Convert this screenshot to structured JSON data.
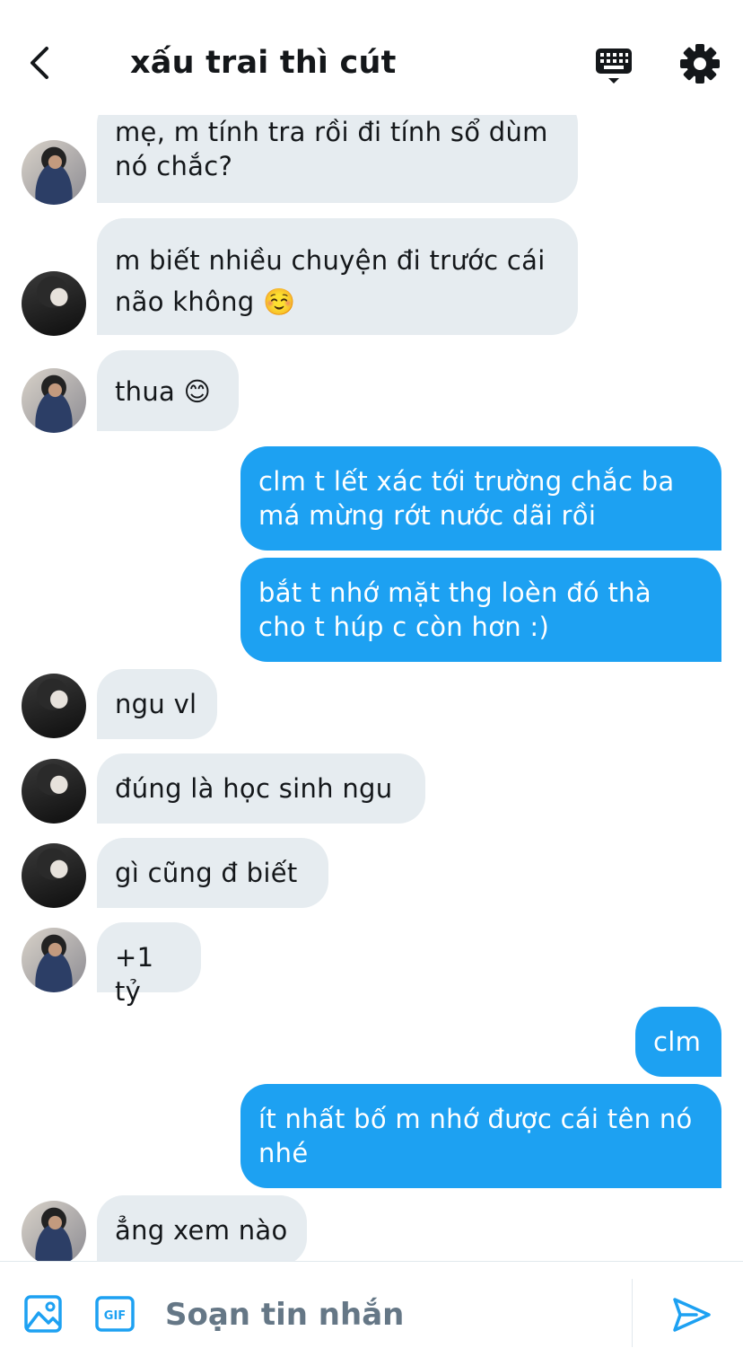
{
  "header": {
    "title": "xấu trai thì cút",
    "back_icon": "chevron-left-icon",
    "keyboard_icon": "keyboard-icon",
    "settings_icon": "gear-icon"
  },
  "messages": [
    {
      "from": "friend-a",
      "text": "mẹ, m tính tra rồi đi tính sổ dùm nó chắc?"
    },
    {
      "from": "friend-b",
      "text": "m biết nhiều chuyện đi trước cái não không ☺️"
    },
    {
      "from": "friend-a",
      "text": "thua 😊"
    },
    {
      "from": "me",
      "text": "clm t lết xác tới trường chắc ba má mừng rớt nước dãi rồi"
    },
    {
      "from": "me",
      "text": "bắt t nhớ mặt thg loèn đó thà cho t húp c còn hơn :)"
    },
    {
      "from": "friend-b",
      "text": "ngu vl"
    },
    {
      "from": "friend-b",
      "text": "đúng là học sinh ngu"
    },
    {
      "from": "friend-b",
      "text": "gì cũng đ biết"
    },
    {
      "from": "friend-a",
      "text": "+1 tỷ"
    },
    {
      "from": "me",
      "text": "clm"
    },
    {
      "from": "me",
      "text": "ít nhất bố m nhớ được cái tên nó nhé"
    },
    {
      "from": "friend-a",
      "text": "ẳng xem nào"
    }
  ],
  "composer": {
    "placeholder": "Soạn tin nhắn",
    "gif_label": "GIF",
    "image_icon": "image-icon",
    "send_icon": "send-icon"
  },
  "colors": {
    "outgoing_bubble": "#1da1f2",
    "incoming_bubble": "#e6ecf0",
    "accent": "#1da1f2",
    "text": "#14171a",
    "placeholder": "#657786"
  }
}
